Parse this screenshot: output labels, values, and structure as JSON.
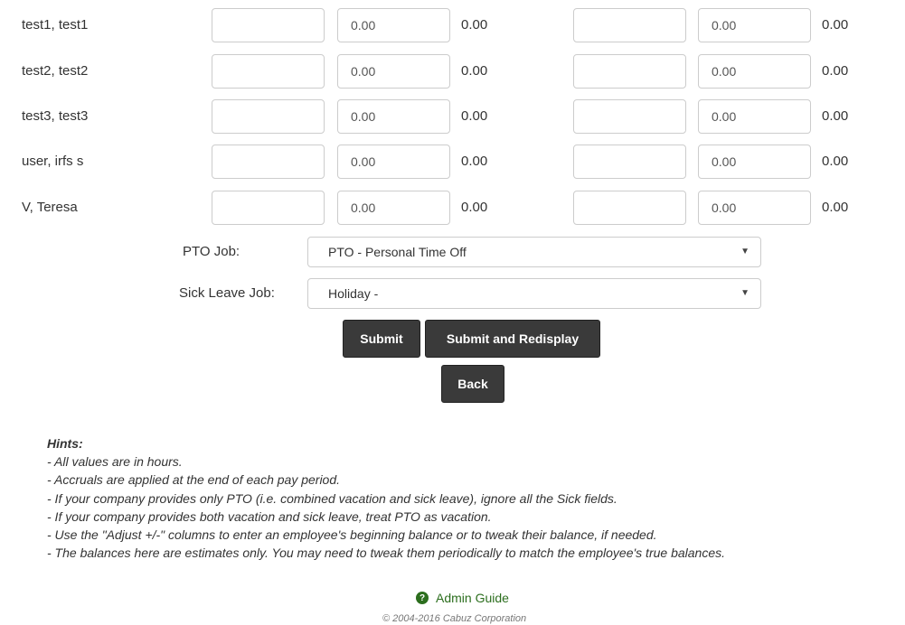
{
  "employees": [
    {
      "name": "test1, test1",
      "adj1": "",
      "amt1": "0.00",
      "bal1": "0.00",
      "adj2": "",
      "amt2": "0.00",
      "bal2": "0.00"
    },
    {
      "name": "test2, test2",
      "adj1": "",
      "amt1": "0.00",
      "bal1": "0.00",
      "adj2": "",
      "amt2": "0.00",
      "bal2": "0.00"
    },
    {
      "name": "test3, test3",
      "adj1": "",
      "amt1": "0.00",
      "bal1": "0.00",
      "adj2": "",
      "amt2": "0.00",
      "bal2": "0.00"
    },
    {
      "name": "user, irfs s",
      "adj1": "",
      "amt1": "0.00",
      "bal1": "0.00",
      "adj2": "",
      "amt2": "0.00",
      "bal2": "0.00"
    },
    {
      "name": "V, Teresa",
      "adj1": "",
      "amt1": "0.00",
      "bal1": "0.00",
      "adj2": "",
      "amt2": "0.00",
      "bal2": "0.00"
    }
  ],
  "pto_job": {
    "label": "PTO Job:",
    "value": "PTO - Personal Time Off"
  },
  "sick_job": {
    "label": "Sick Leave Job:",
    "value": "Holiday -"
  },
  "buttons": {
    "submit": "Submit",
    "submit_redisplay": "Submit and Redisplay",
    "back": "Back"
  },
  "hints": {
    "title": "Hints:",
    "lines": [
      "- All values are in hours.",
      "- Accruals are applied at the end of each pay period.",
      "- If your company provides only PTO (i.e. combined vacation and sick leave), ignore all the Sick fields.",
      "- If your company provides both vacation and sick leave, treat PTO as vacation.",
      "- Use the \"Adjust +/-\" columns to enter an employee's beginning balance or to tweak their balance, if needed.",
      "- The balances here are estimates only. You may need to tweak them periodically to match the employee's true balances."
    ]
  },
  "footer": {
    "guide": "Admin Guide",
    "copyright": "© 2004-2016 Cabuz Corporation"
  },
  "icons": {
    "caret": "chevron-down-icon",
    "help": "question-circle-icon"
  },
  "colors": {
    "button": "#3a3a3a",
    "guide_link": "#2c6e1e"
  }
}
